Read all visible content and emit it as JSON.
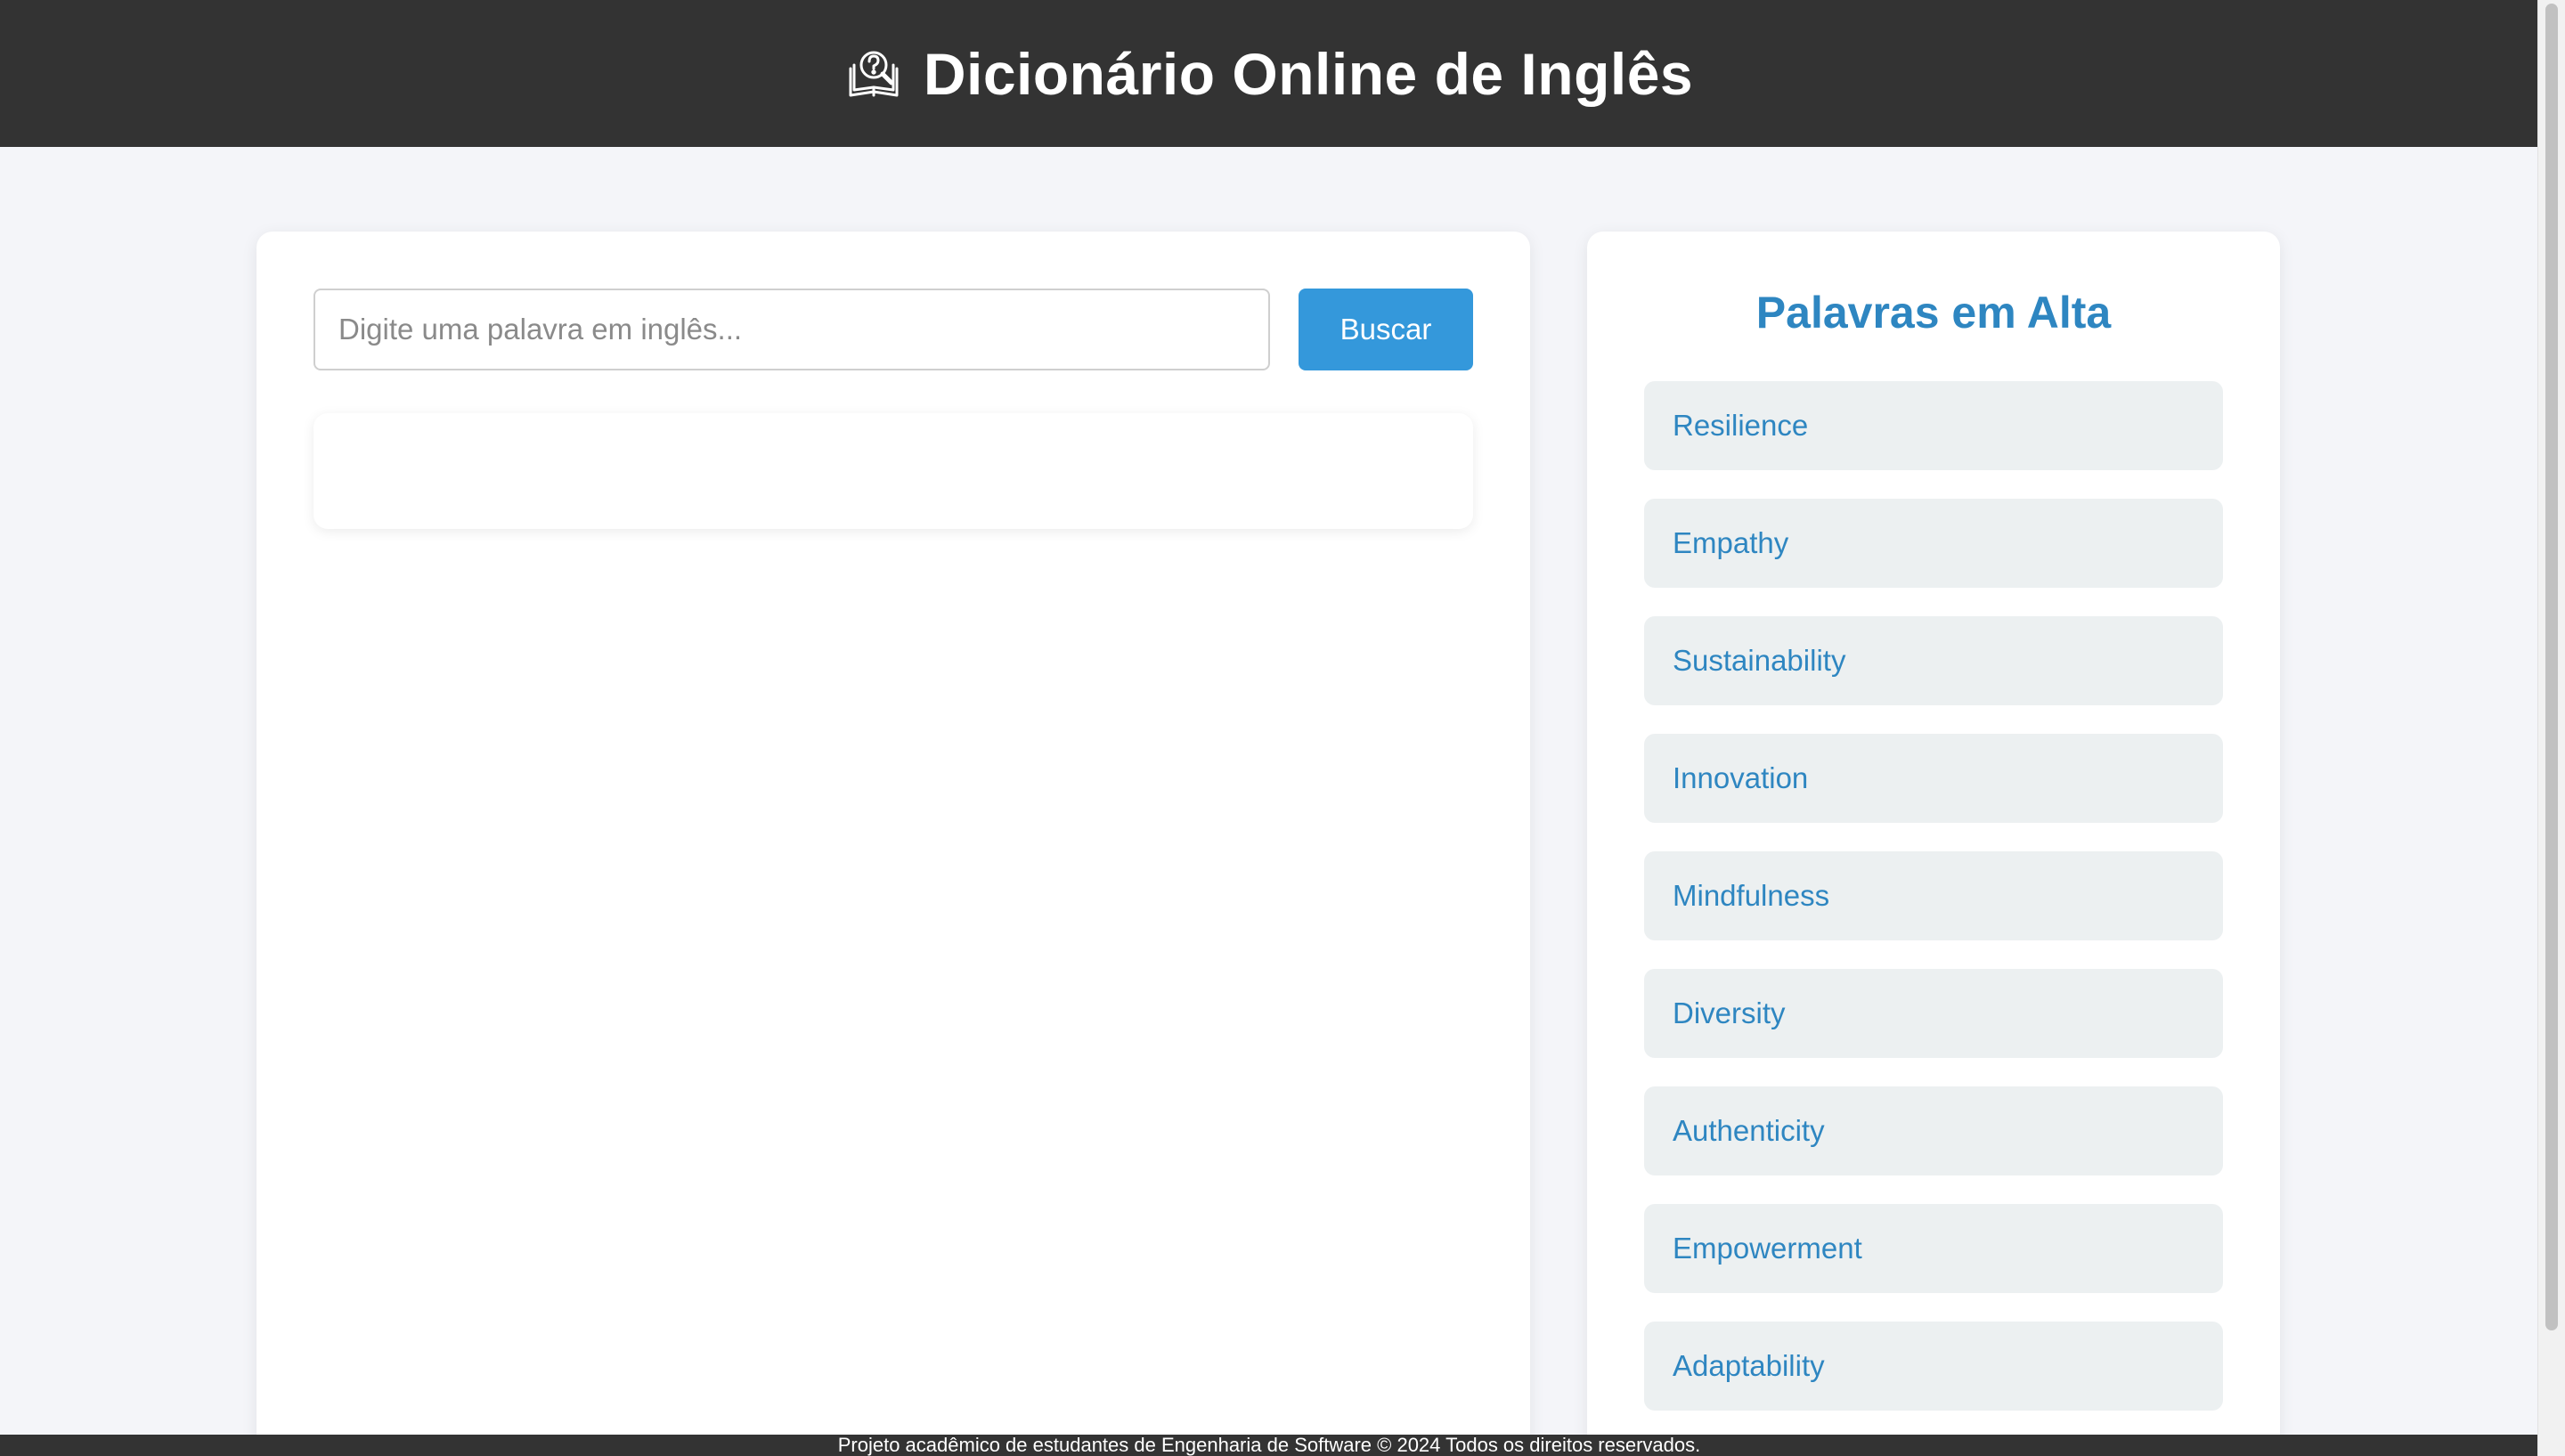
{
  "header": {
    "icon": "dictionary-search-icon",
    "title": "Dicionário Online de Inglês"
  },
  "search": {
    "placeholder": "Digite uma palavra em inglês...",
    "value": "",
    "button_label": "Buscar"
  },
  "result": {
    "text": ""
  },
  "trending": {
    "title": "Palavras em Alta",
    "items": [
      {
        "label": "Resilience"
      },
      {
        "label": "Empathy"
      },
      {
        "label": "Sustainability"
      },
      {
        "label": "Innovation"
      },
      {
        "label": "Mindfulness"
      },
      {
        "label": "Diversity"
      },
      {
        "label": "Authenticity"
      },
      {
        "label": "Empowerment"
      },
      {
        "label": "Adaptability"
      }
    ]
  },
  "footer": {
    "text": "Projeto acadêmico de estudantes de Engenharia de Software © 2024 Todos os direitos reservados."
  },
  "colors": {
    "header_bg": "#333333",
    "page_bg": "#f4f5f9",
    "accent": "#3498db",
    "link": "#2e86c1",
    "word_bg": "#ecf0f1"
  }
}
